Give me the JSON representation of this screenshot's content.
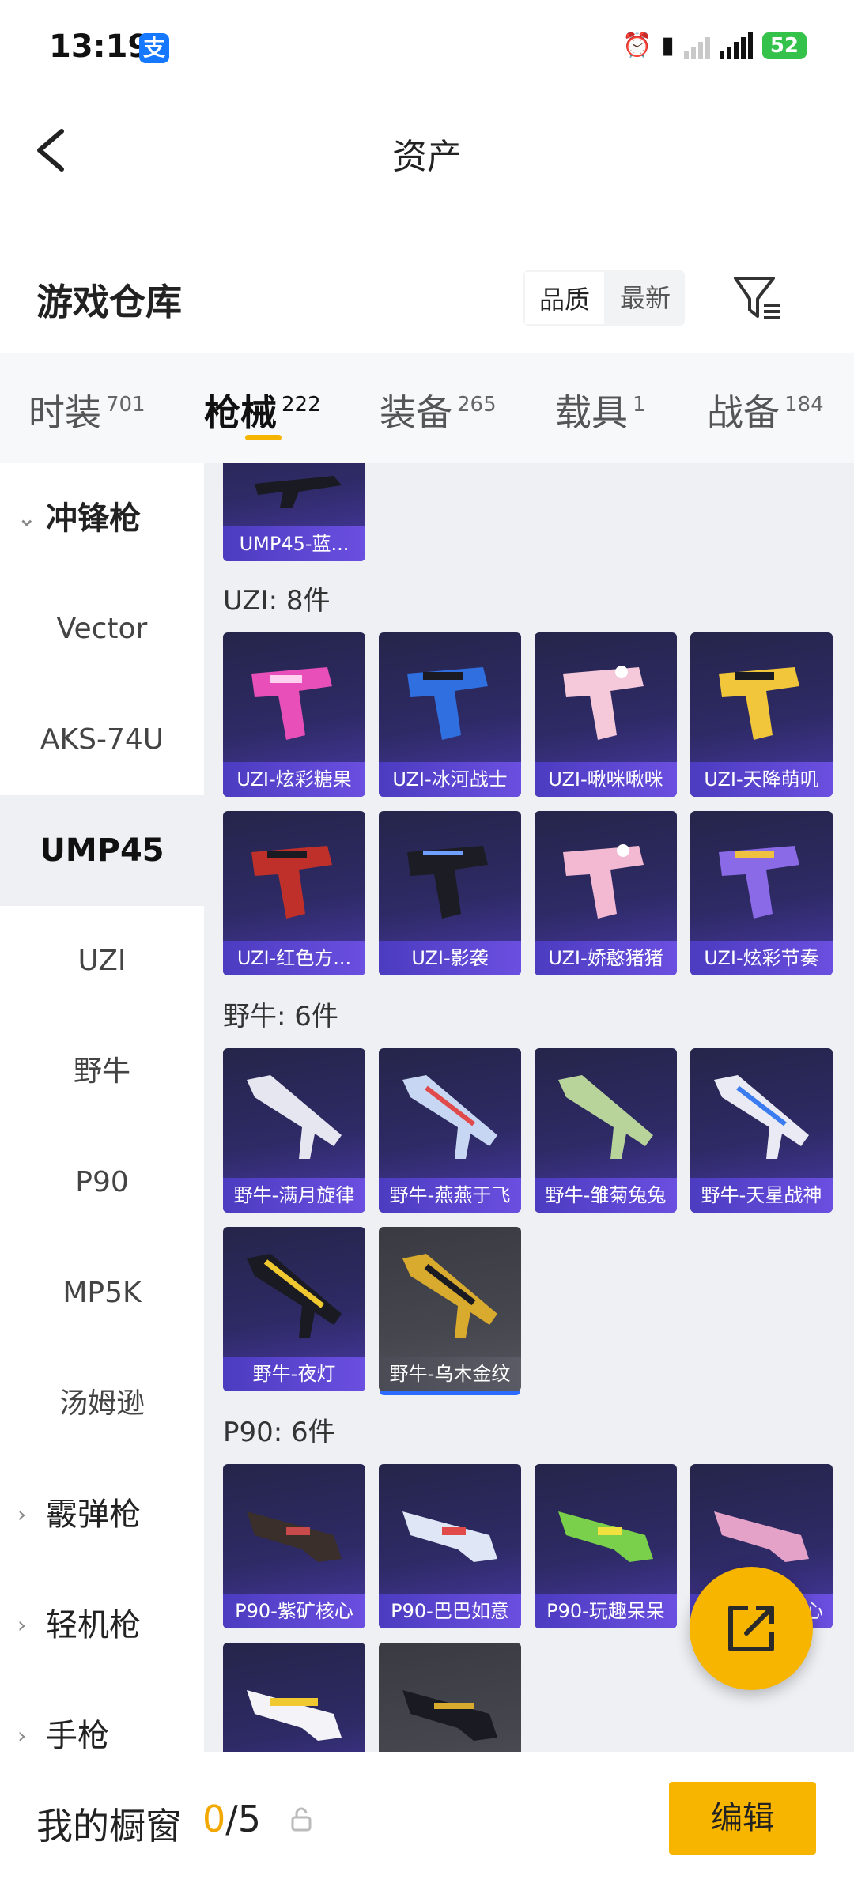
{
  "status": {
    "time": "13:19",
    "battery": "52"
  },
  "nav": {
    "title": "资产"
  },
  "warehouse": {
    "title": "游戏仓库",
    "sort_quality": "品质",
    "sort_latest": "最新"
  },
  "tabs": [
    {
      "label": "时装",
      "count": "701"
    },
    {
      "label": "枪械",
      "count": "222"
    },
    {
      "label": "装备",
      "count": "265"
    },
    {
      "label": "载具",
      "count": "1"
    },
    {
      "label": "战备",
      "count": "184"
    }
  ],
  "sidebar": {
    "submachine": "冲锋枪",
    "items": [
      "Vector",
      "AKS-74U",
      "UMP45",
      "UZI",
      "野牛",
      "P90",
      "MP5K",
      "汤姆逊"
    ],
    "shotgun": "霰弹枪",
    "lmg": "轻机枪",
    "pistol": "手枪"
  },
  "content": {
    "partial_top": "UMP45-蓝...",
    "uzi_title": "UZI: 8件",
    "uzi": [
      "UZI-炫彩糖果",
      "UZI-冰河战士",
      "UZI-啾咪啾咪",
      "UZI-天降萌叽",
      "UZI-红色方...",
      "UZI-影袭",
      "UZI-娇憨猪猪",
      "UZI-炫彩节奏"
    ],
    "bison_title": "野牛: 6件",
    "bison": [
      "野牛-满月旋律",
      "野牛-燕燕于飞",
      "野牛-雏菊兔兔",
      "野牛-天星战神",
      "野牛-夜灯",
      "野牛-乌木金纹"
    ],
    "p90_title": "P90: 6件",
    "p90": [
      "P90-紫矿核心",
      "P90-巴巴如意",
      "P90-玩趣呆呆",
      "心"
    ]
  },
  "bottom": {
    "showcase_label": "我的橱窗",
    "count_current": "0",
    "count_total": "/5",
    "edit": "编辑"
  },
  "colors": {
    "accent": "#f7b500",
    "card_purple": "#3a2f8a"
  }
}
